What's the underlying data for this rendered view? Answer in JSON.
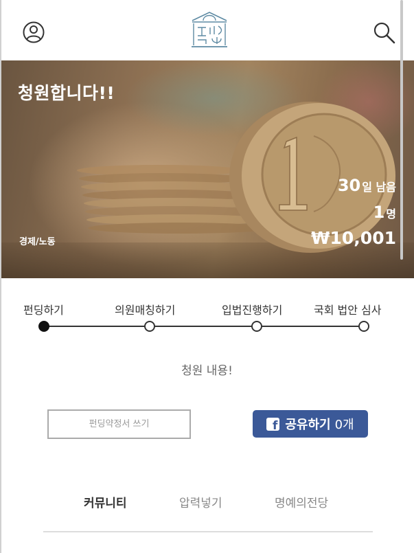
{
  "header": {
    "profile_icon": "user-circle-icon",
    "logo_icon": "assembly-logo-icon",
    "search_icon": "search-icon"
  },
  "hero": {
    "title": "청원합니다!!",
    "category": "경제/노동",
    "days_value": "30",
    "days_unit": "일 남음",
    "people_value": "1",
    "people_unit": "명",
    "amount": "₩10,001"
  },
  "steps": [
    {
      "label": "펀딩하기",
      "active": true
    },
    {
      "label": "의원매칭하기",
      "active": false
    },
    {
      "label": "입법진행하기",
      "active": false
    },
    {
      "label": "국회 법안 심사",
      "active": false
    }
  ],
  "content": {
    "text": "청원 내용!"
  },
  "actions": {
    "pledge_label": "펀딩약정서 쓰기",
    "share_label": "공유하기",
    "share_count": "0개",
    "share_color": "#3b5998"
  },
  "tabs": [
    {
      "label": "커뮤니티",
      "active": true
    },
    {
      "label": "압력넣기",
      "active": false
    },
    {
      "label": "명예의전당",
      "active": false
    }
  ]
}
